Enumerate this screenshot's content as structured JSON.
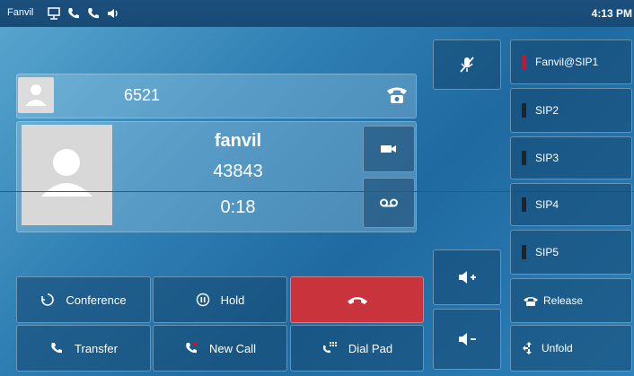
{
  "status_bar": {
    "brand": "Fanvil",
    "time": "4:13 PM"
  },
  "top_line": {
    "number": "6521"
  },
  "call": {
    "name": "fanvil",
    "number": "43843",
    "duration": "0:18"
  },
  "actions": {
    "conference": "Conference",
    "hold": "Hold",
    "transfer": "Transfer",
    "new_call": "New Call",
    "dial_pad": "Dial Pad"
  },
  "lines": [
    {
      "label": "Fanvil@SIP1",
      "status_color": "#d0122a"
    },
    {
      "label": "SIP2",
      "status_color": "#1b1b1b"
    },
    {
      "label": "SIP3",
      "status_color": "#1b1b1b"
    },
    {
      "label": "SIP4",
      "status_color": "#1b1b1b"
    },
    {
      "label": "SIP5",
      "status_color": "#1b1b1b"
    }
  ],
  "side": {
    "release": "Release",
    "unfold": "Unfold"
  },
  "colors": {
    "end_call": "#c9333b",
    "separator": "#cc1b1b"
  }
}
